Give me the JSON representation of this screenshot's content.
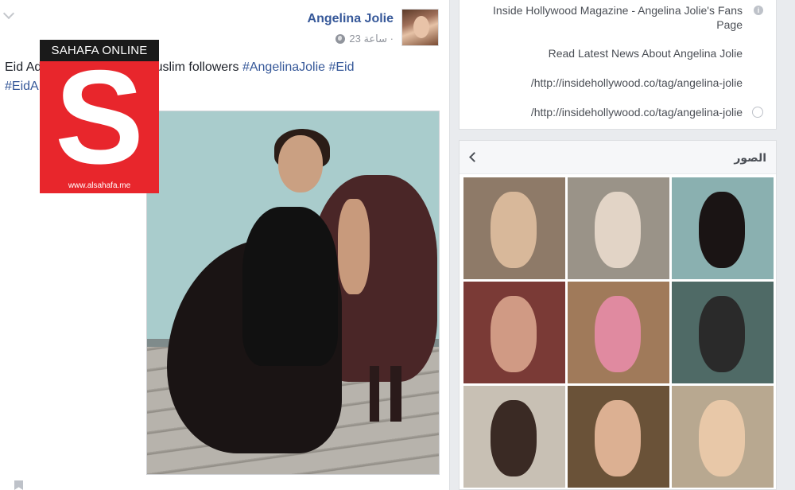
{
  "post": {
    "author": "Angelina Jolie",
    "time": "23 ساعة ·",
    "text": {
      "prefix": "Eid Ad",
      "middle": "muslim followers ",
      "tags": [
        "#AngelinaJolie",
        "#Eid",
        "#EidA"
      ]
    }
  },
  "watermark": {
    "brand": "SAHAFA ONLINE",
    "letter": "S",
    "url": "www.alsahafa.me"
  },
  "about": {
    "title": "Inside Hollywood Magazine - Angelina Jolie's Fans Page",
    "news": "Read Latest News About Angelina Jolie",
    "link1": "/http://insidehollywood.co/tag/angelina-jolie",
    "link2": "/http://insidehollywood.co/tag/angelina-jolie"
  },
  "photos": {
    "title": "الصور",
    "thumbs": [
      {
        "bg": "#8e7a68",
        "fig": "#d8b89a"
      },
      {
        "bg": "#9a9388",
        "fig": "#e2d4c6"
      },
      {
        "bg": "#8ab0b0",
        "fig": "#1a1414"
      },
      {
        "bg": "#7a3a36",
        "fig": "#d09a84"
      },
      {
        "bg": "#a07a5a",
        "fig": "#e08aa0"
      },
      {
        "bg": "#4f6a66",
        "fig": "#2a2a2a"
      },
      {
        "bg": "#c8c0b4",
        "fig": "#3a2a24"
      },
      {
        "bg": "#6a5238",
        "fig": "#dcb092"
      },
      {
        "bg": "#b8a890",
        "fig": "#e8c8a8"
      }
    ]
  },
  "colors": {
    "link": "#365899",
    "logo_red": "#e8262c",
    "page_bg": "#e9ebee"
  }
}
